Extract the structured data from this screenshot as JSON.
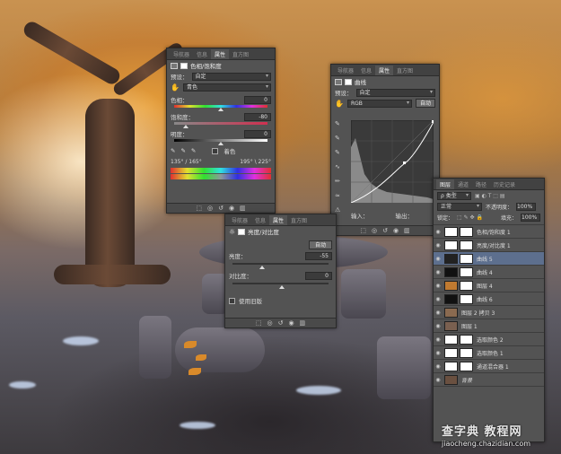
{
  "hue_panel": {
    "tabs": [
      "导航器",
      "信息",
      "属性",
      "直方图"
    ],
    "active_tab": 2,
    "title": "色相/饱和度",
    "preset_label": "预设：",
    "preset_value": "自定",
    "channel_value": "青色",
    "hue_label": "色相：",
    "hue_value": "0",
    "sat_label": "饱和度：",
    "sat_value": "-80",
    "light_label": "明度：",
    "light_value": "0",
    "colorize_label": "着色",
    "range_left": "135° / 165°",
    "range_right": "195° \\ 225°"
  },
  "curves_panel": {
    "tabs": [
      "导航器",
      "信息",
      "属性",
      "直方图"
    ],
    "active_tab": 2,
    "title": "曲线",
    "preset_label": "预设：",
    "preset_value": "自定",
    "channel_value": "RGB",
    "auto_label": "自动",
    "input_label": "输入：",
    "output_label": "输出："
  },
  "brightness_panel": {
    "tabs": [
      "导航器",
      "信息",
      "属性",
      "直方图"
    ],
    "active_tab": 2,
    "title": "亮度/对比度",
    "auto_label": "自动",
    "brightness_label": "亮度：",
    "brightness_value": "-55",
    "contrast_label": "对比度：",
    "contrast_value": "0",
    "legacy_label": "使用旧版"
  },
  "layers_panel": {
    "tabs": [
      "图层",
      "通道",
      "路径",
      "历史记录"
    ],
    "active_tab": 0,
    "kind_label": "ρ 类型",
    "blend_mode": "正常",
    "opacity_label": "不透明度：",
    "opacity_value": "100%",
    "lock_label": "锁定：",
    "fill_label": "填充：",
    "fill_value": "100%",
    "layers": [
      {
        "name": "色相/饱和度 1",
        "thumb": "#ffffff",
        "mask": true,
        "selected": false
      },
      {
        "name": "亮度/对比度 1",
        "thumb": "#ffffff",
        "mask": true,
        "selected": false
      },
      {
        "name": "曲线 5",
        "thumb": "#222222",
        "mask": true,
        "selected": true
      },
      {
        "name": "曲线 4",
        "thumb": "#111111",
        "mask": true,
        "selected": false
      },
      {
        "name": "图层 4",
        "thumb": "#c07a30",
        "mask": true,
        "selected": false
      },
      {
        "name": "曲线 6",
        "thumb": "#111111",
        "mask": true,
        "selected": false
      },
      {
        "name": "图层 2 拷贝 3",
        "thumb": "#8a6a50",
        "mask": false,
        "selected": false
      },
      {
        "name": "图层 1",
        "thumb": "#7a6050",
        "mask": false,
        "selected": false
      },
      {
        "name": "选取颜色 2",
        "thumb": "#ffffff",
        "mask": true,
        "selected": false
      },
      {
        "name": "选取颜色 1",
        "thumb": "#ffffff",
        "mask": true,
        "selected": false
      },
      {
        "name": "通道混合器 1",
        "thumb": "#ffffff",
        "mask": true,
        "selected": false
      },
      {
        "name": "背景",
        "thumb": "#6a5040",
        "mask": false,
        "selected": false
      }
    ]
  },
  "watermark": {
    "title": "查字典 教程网",
    "url": "jiaocheng.chazidian.com"
  }
}
